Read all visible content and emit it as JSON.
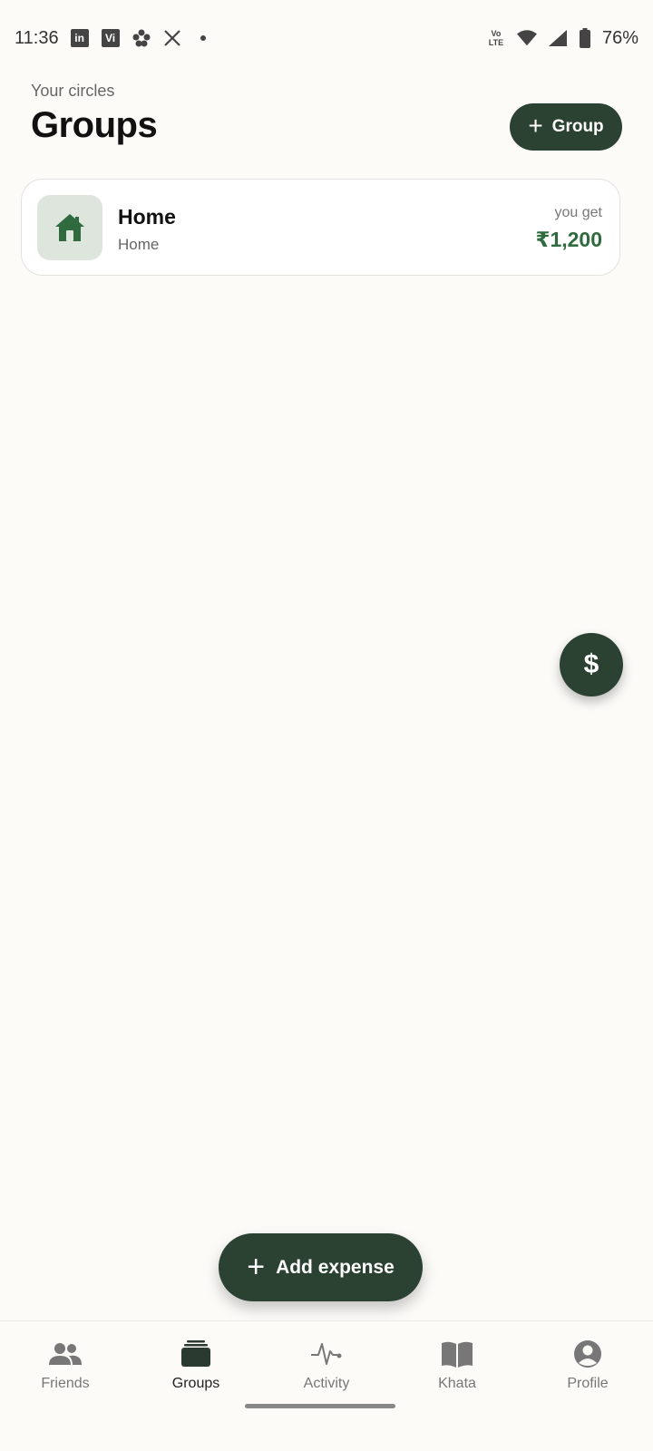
{
  "status_bar": {
    "time": "11:36",
    "notification_icons": [
      "linkedin-icon",
      "vi-icon",
      "flower-icon",
      "x-icon",
      "dot-icon"
    ],
    "linkedin_text": "in",
    "vi_text": "Vi",
    "battery": "76%",
    "volte_line1": "Vo",
    "volte_line2": "LTE"
  },
  "header": {
    "subtitle": "Your circles",
    "title": "Groups",
    "add_group_label": "Group"
  },
  "groups": [
    {
      "name": "Home",
      "type": "Home",
      "balance_label": "you get",
      "balance": "₹1,200",
      "icon": "house-icon"
    }
  ],
  "fab": {
    "side_symbol": "$",
    "add_expense_label": "Add expense"
  },
  "nav": {
    "items": [
      {
        "label": "Friends",
        "icon": "friends-icon",
        "active": false
      },
      {
        "label": "Groups",
        "icon": "groups-icon",
        "active": true
      },
      {
        "label": "Activity",
        "icon": "activity-icon",
        "active": false
      },
      {
        "label": "Khata",
        "icon": "book-icon",
        "active": false
      },
      {
        "label": "Profile",
        "icon": "profile-icon",
        "active": false
      }
    ]
  },
  "colors": {
    "background": "#fcfbf8",
    "primary": "#2b4232",
    "positive": "#2f6b3f",
    "icon_tile": "#dde5dd"
  }
}
